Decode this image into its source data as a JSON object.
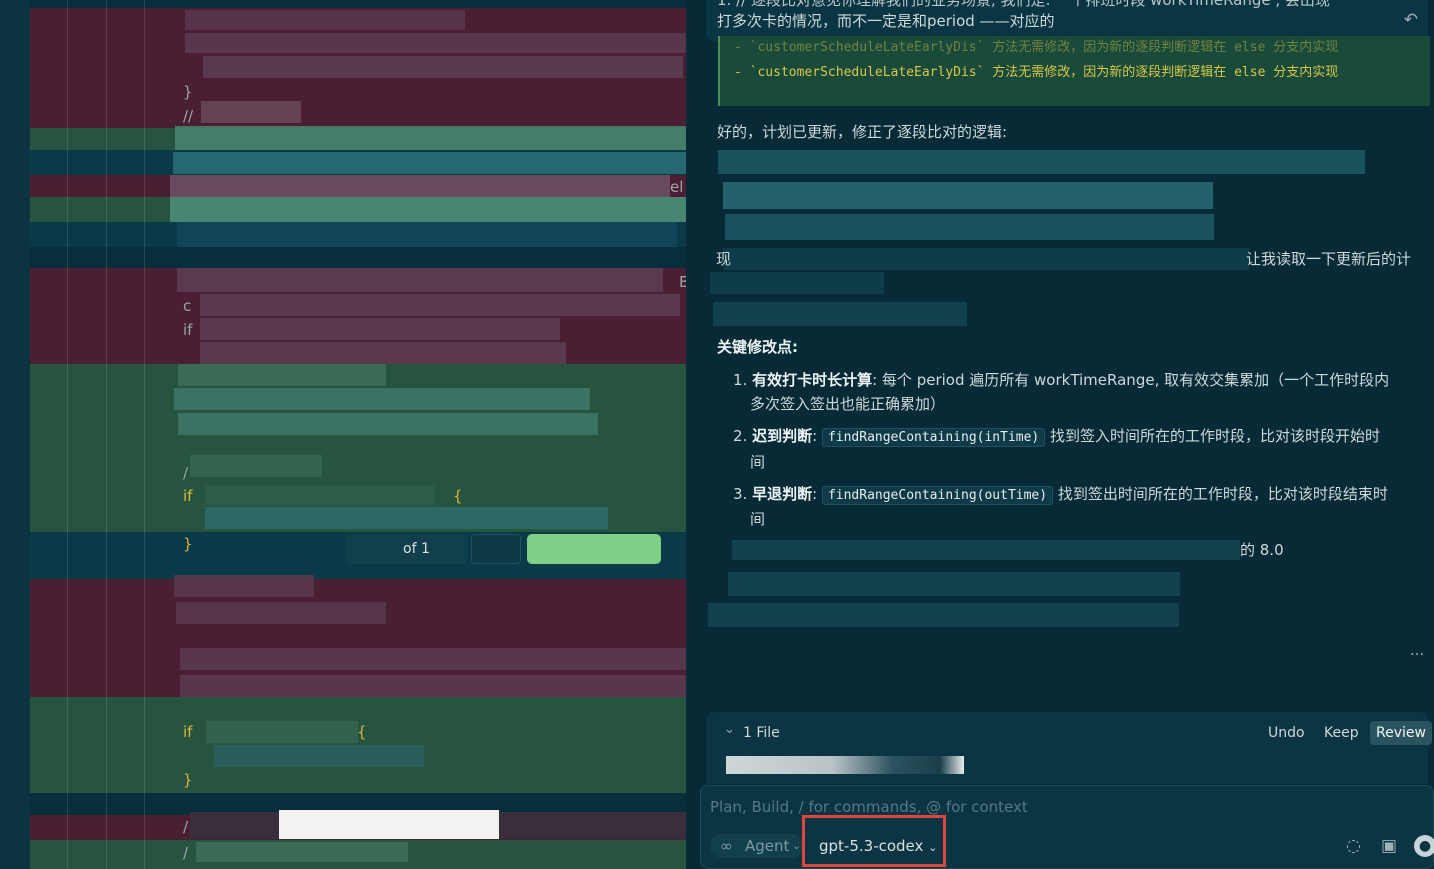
{
  "editor": {
    "tokens": {
      "close_brace": "}",
      "comment_slashes": "//",
      "el_fragment": "el",
      "c_char": "c",
      "if_kw": "if",
      "open_brace": "{",
      "slash": "/",
      "b_char": "B"
    },
    "find_widget": {
      "count_text": "of 1"
    }
  },
  "chat": {
    "top_line_1": "1. // 逐段比对意见你理解我们的业务场景, 我们是:    一个排班时段 workTimeRange , 会出现",
    "top_line_2": "打多次卡的情况，而不一定是和period ——对应的",
    "plan_lines": [
      "- `customerScheduleLateEarlyDis` 方法无需修改，因为新的逐段判断逻辑在 else 分支内实现",
      "- `customerScheduleLateEarlyDis` 方法无需修改，因为新的逐段判断逻辑在 else 分支内实现"
    ],
    "updated_msg": "好的，计划已更新，修正了逐段比对的逻辑:",
    "read_prefix": "现",
    "read_suffix": "让我读取一下更新后的计",
    "key_changes_title": "关键修改点:",
    "items": [
      {
        "num": "1.",
        "bold": "有效打卡时长计算",
        "text": ": 每个 period 遍历所有 workTimeRange, 取有效交集累加（一个工作时段内",
        "cont": "多次签入签出也能正确累加）"
      },
      {
        "num": "2.",
        "bold": "迟到判断",
        "text_before": ": ",
        "code": "findRangeContaining(inTime)",
        "text": " 找到签入时间所在的工作时段，比对该时段开始时",
        "cont": "间"
      },
      {
        "num": "3.",
        "bold": "早退判断",
        "text_before": ": ",
        "code": "findRangeContaining(outTime)",
        "text": " 找到签出时间所在的工作时段，比对该时段结束时",
        "cont": "间"
      }
    ],
    "version_suffix": "的 8.0",
    "more_dots": "...",
    "file_panel": {
      "files_label": "1 File",
      "undo_label": "Undo",
      "keep_label": "Keep",
      "review_label": "Review"
    },
    "composer": {
      "placeholder": "Plan, Build, / for commands, @ for context",
      "agent_label": "Agent",
      "model_label": "gpt-5.3-codex"
    },
    "icons": [
      "undo-arrow-icon",
      "chevron-down-icon",
      "infinity-icon",
      "spinner-icon",
      "image-icon",
      "microphone-icon"
    ],
    "colors": {
      "highlight": "#e0453f",
      "accent_green": "#7fcf86"
    }
  }
}
